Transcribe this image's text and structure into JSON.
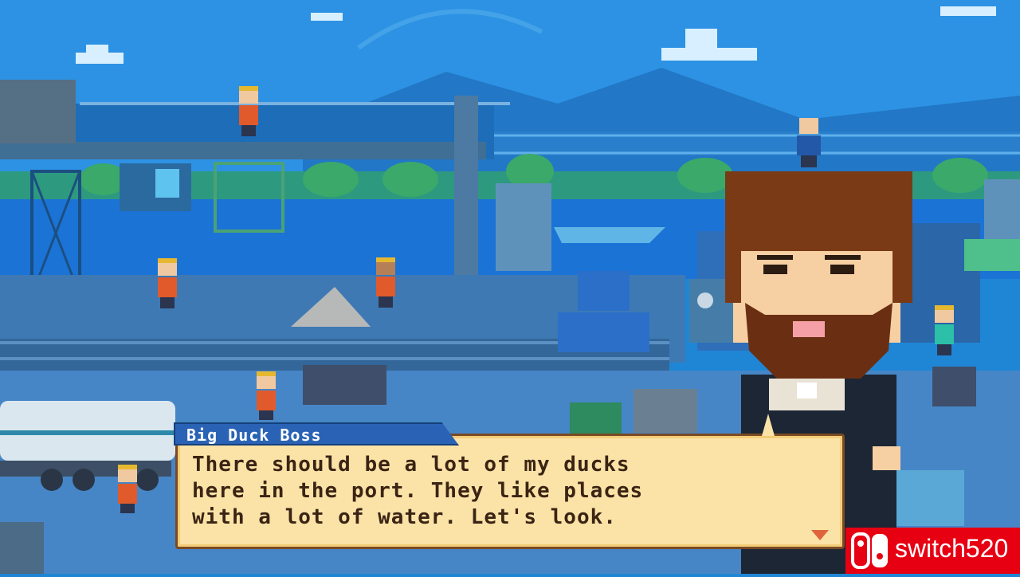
{
  "dialog": {
    "speaker": "Big Duck Boss",
    "text": "There should be a lot of my ducks\nhere in the port. They like places\nwith a lot of water. Let's look.",
    "next_icon": "triangle-down-icon",
    "colors": {
      "box": "#fbe3a7",
      "border": "#7a4a23",
      "name_bar": "#2a63b5",
      "text": "#3b2414"
    }
  },
  "watermark": {
    "text": "switch520",
    "logo": "nintendo-switch-logo-icon",
    "color": "#e60012"
  }
}
